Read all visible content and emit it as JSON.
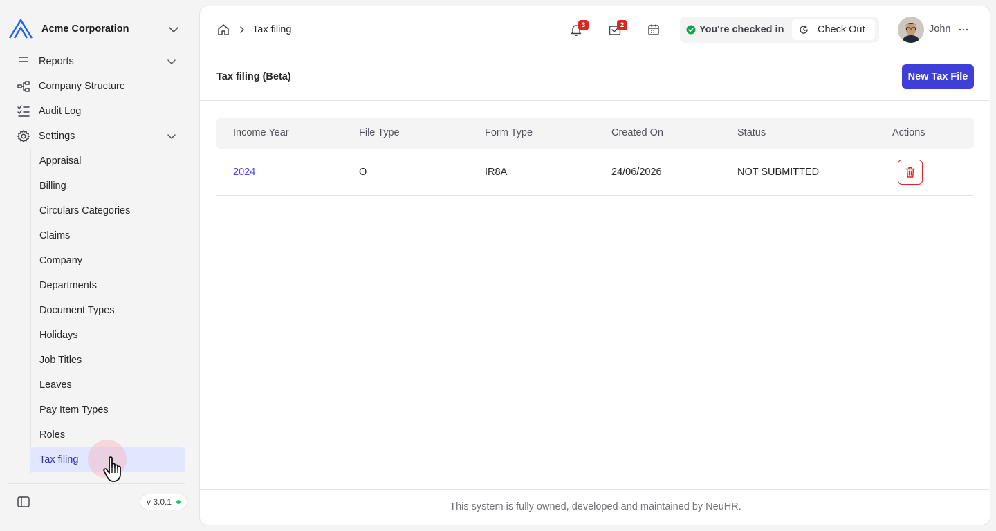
{
  "sidebar": {
    "org_name": "Acme Corporation",
    "nav": [
      {
        "label": "Reports",
        "icon": "reports-icon"
      },
      {
        "label": "Company Structure",
        "icon": "company-structure-icon"
      },
      {
        "label": "Audit Log",
        "icon": "audit-log-icon"
      },
      {
        "label": "Settings",
        "icon": "settings-gear-icon"
      }
    ],
    "settings_items": [
      "Appraisal",
      "Billing",
      "Circulars Categories",
      "Claims",
      "Company",
      "Departments",
      "Document Types",
      "Holidays",
      "Job Titles",
      "Leaves",
      "Pay Item Types",
      "Roles",
      "Tax filing"
    ],
    "active_item": "Tax filing",
    "version": "v 3.0.1"
  },
  "topbar": {
    "breadcrumb": "Tax filing",
    "notifications_count": "3",
    "inbox_count": "2",
    "checkin_status": "You're checked in",
    "checkout_label": "Check Out",
    "user_name": "John"
  },
  "page": {
    "title": "Tax filing (Beta)",
    "new_button": "New Tax File"
  },
  "table": {
    "columns": [
      "Income Year",
      "File Type",
      "Form Type",
      "Created On",
      "Status",
      "Actions"
    ],
    "rows": [
      {
        "income_year": "2024",
        "file_type": "O",
        "form_type": "IR8A",
        "created_on": "24/06/2026",
        "status": "NOT SUBMITTED"
      }
    ]
  },
  "footer": {
    "text": "This system is fully owned, developed and maintained by NeuHR."
  },
  "colors": {
    "accent": "#3f3fd8",
    "active_bg": "#e0e7ff",
    "danger": "#dc2626",
    "success": "#16a34a"
  }
}
